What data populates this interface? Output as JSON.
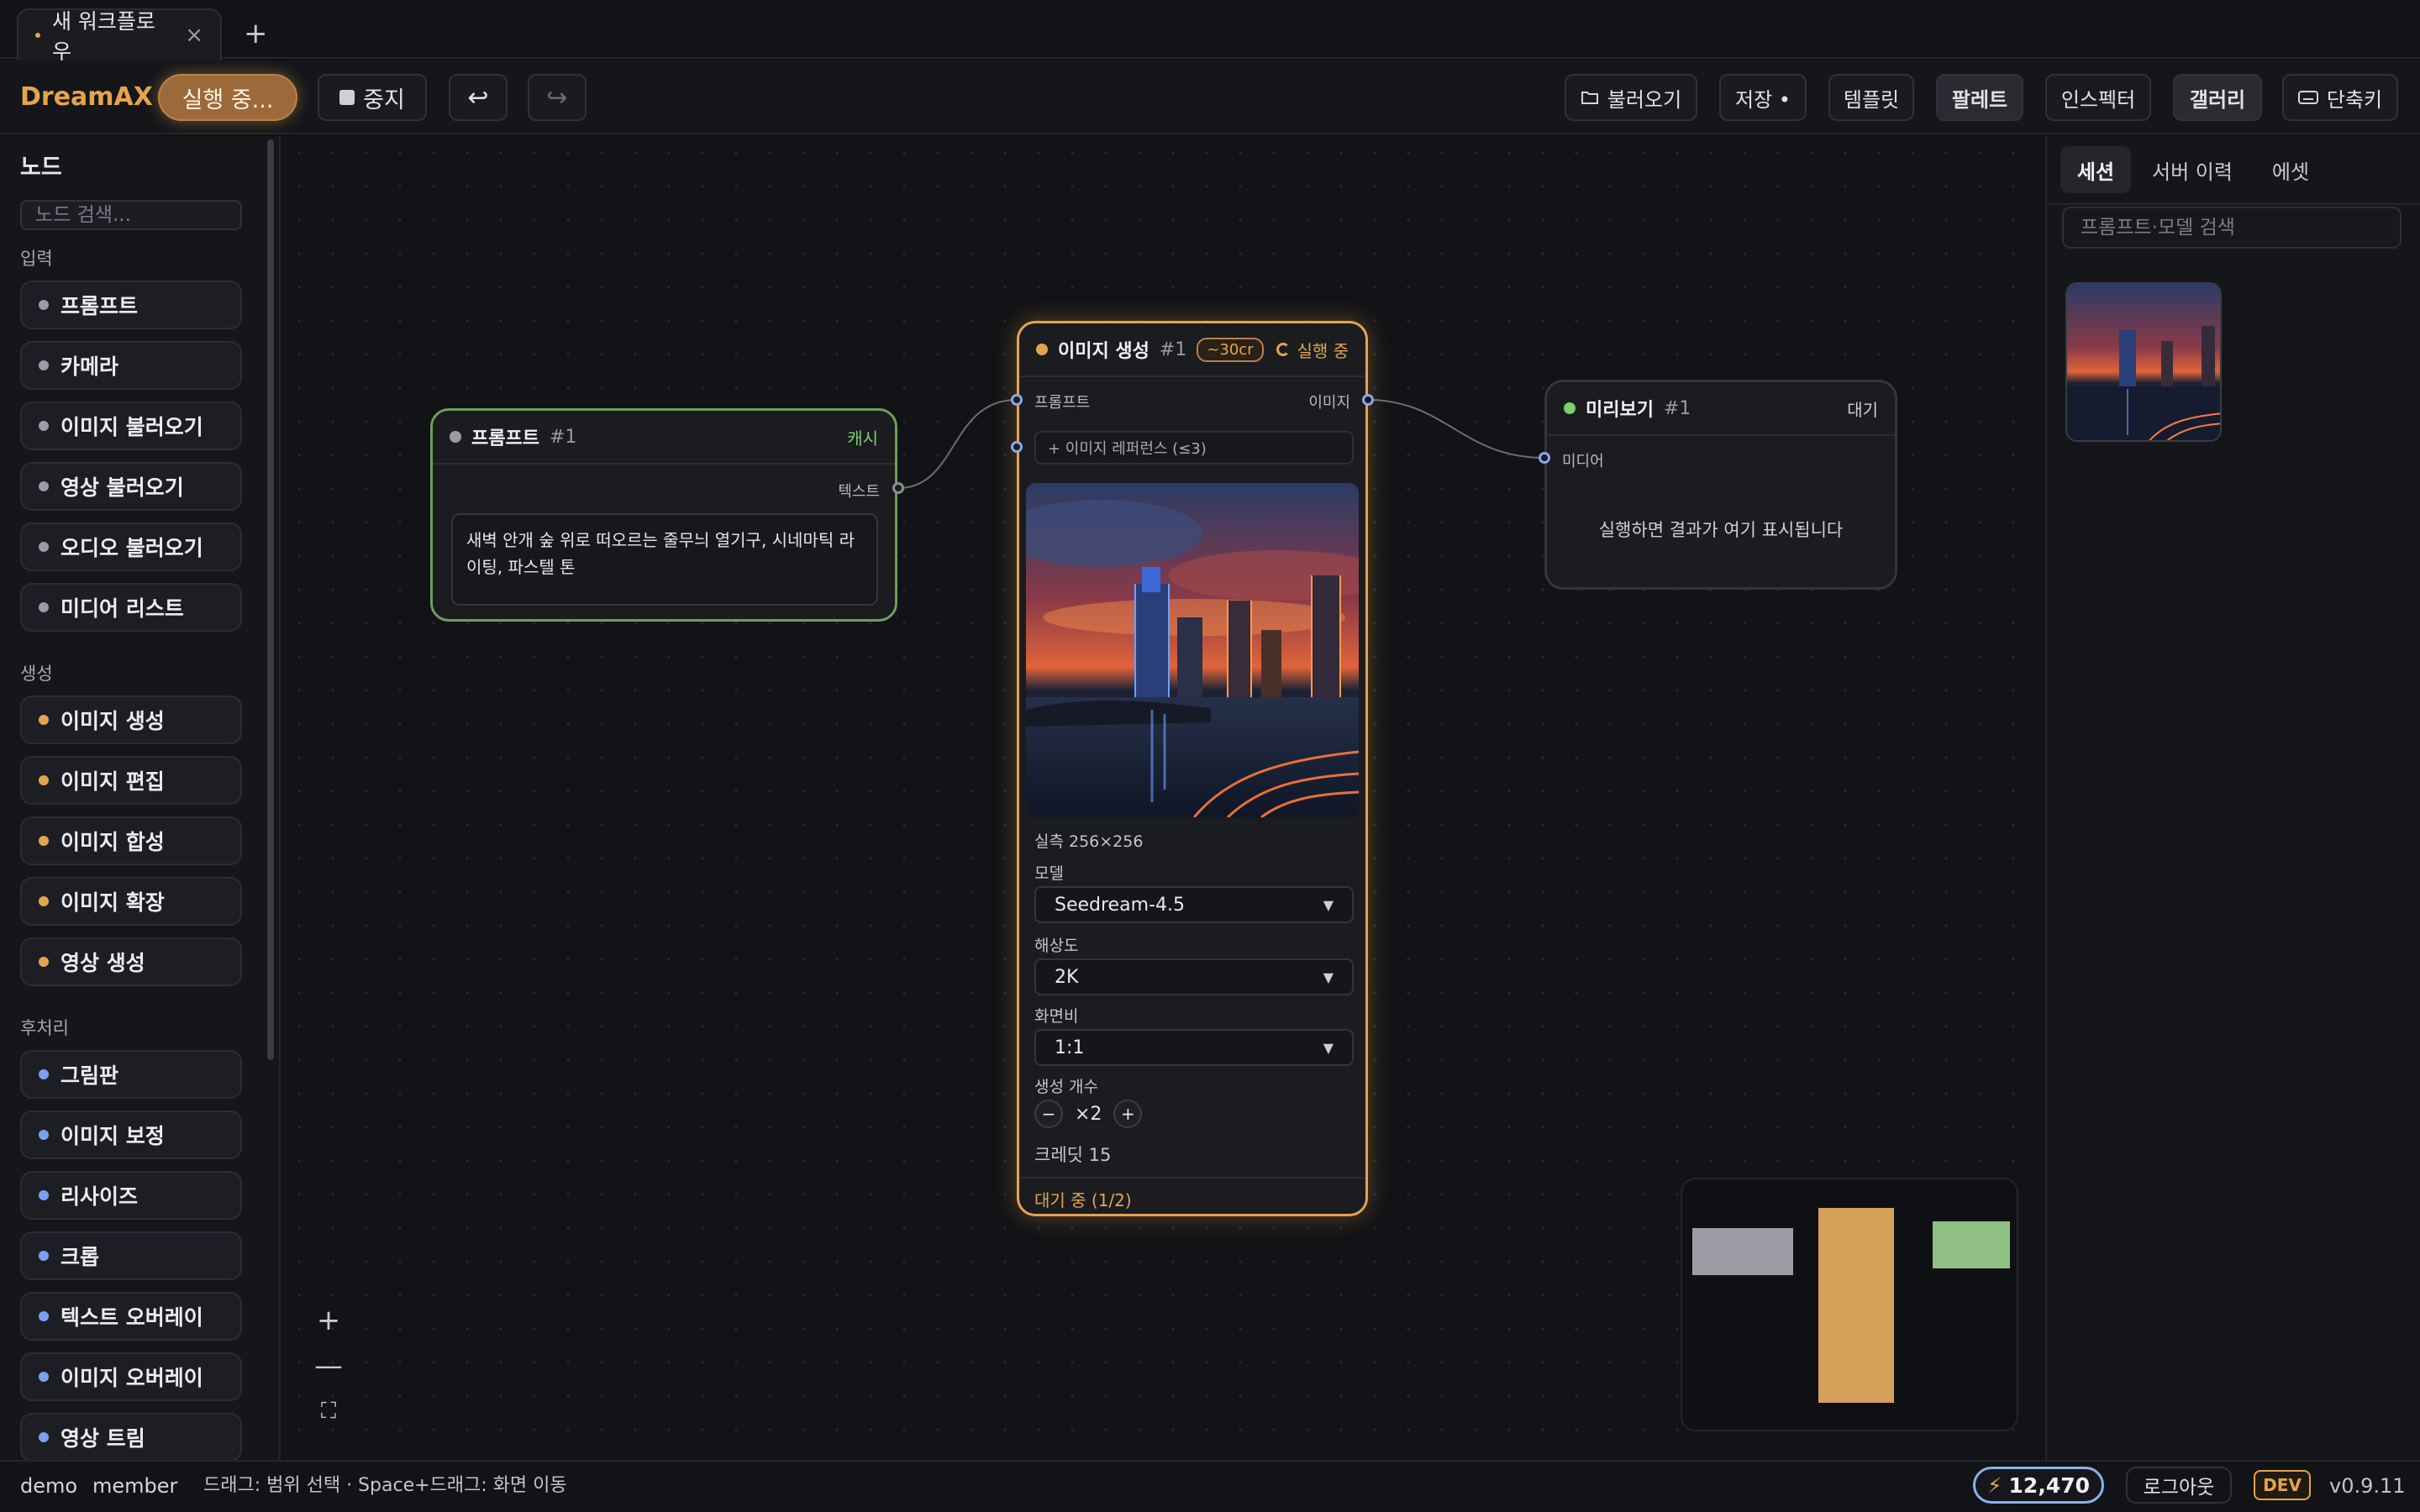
{
  "tab": {
    "title": "새 워크플로우",
    "close": "×",
    "new": "+"
  },
  "toolbar": {
    "logo": "DreamAX",
    "running": "실행 중...",
    "stop": "중지",
    "undo": "↩",
    "redo": "↪",
    "load": "불러오기",
    "save": "저장 •",
    "template": "템플릿",
    "palette": "팔레트",
    "inspector": "인스펙터",
    "gallery": "갤러리",
    "shortcuts": "단축키"
  },
  "sidebar": {
    "title": "노드",
    "search_placeholder": "노드 검색...",
    "sections": [
      {
        "label": "입력",
        "color": "#9c9ca4",
        "items": [
          "프롬프트",
          "카메라",
          "이미지 불러오기",
          "영상 불러오기",
          "오디오 불러오기",
          "미디어 리스트"
        ]
      },
      {
        "label": "생성",
        "color": "#e5a44c",
        "items": [
          "이미지 생성",
          "이미지 편집",
          "이미지 합성",
          "이미지 확장",
          "영상 생성"
        ]
      },
      {
        "label": "후처리",
        "color": "#7aa0f5",
        "items": [
          "그림판",
          "이미지 보정",
          "리사이즈",
          "크롭",
          "텍스트 오버레이",
          "이미지 오버레이",
          "영상 트림"
        ]
      }
    ]
  },
  "canvas": {
    "zoom_in": "+",
    "zoom_out": "—",
    "fit": "⛶",
    "prompt_node": {
      "title": "프롬프트",
      "num": "#1",
      "badge": "캐시",
      "output_label": "텍스트",
      "text": "새벽 안개 숲 위로 떠오르는 줄무늬 열기구, 시네마틱 라이팅, 파스텔 톤"
    },
    "gen_node": {
      "title": "이미지 생성",
      "num": "#1",
      "cost": "~30cr",
      "status": "실행 중",
      "input_label": "프롬프트",
      "output_label": "이미지",
      "ref_label": "+ 이미지 레퍼런스 (≤3)",
      "actual_size": "실측 256×256",
      "model_label": "모델",
      "model_value": "Seedream-4.5",
      "res_label": "해상도",
      "res_value": "2K",
      "aspect_label": "화면비",
      "aspect_value": "1:1",
      "count_label": "생성 개수",
      "count_minus": "−",
      "count_value": "×2",
      "count_plus": "+",
      "credit": "크레딧 15",
      "footer": "대기 중 (1/2)"
    },
    "preview_node": {
      "title": "미리보기",
      "num": "#1",
      "status": "대기",
      "input_label": "미디어",
      "message": "실행하면 결과가 여기 표시됩니다"
    }
  },
  "right_panel": {
    "tabs": [
      "세션",
      "서버 이력",
      "에셋"
    ],
    "search_placeholder": "프롬프트·모델 검색"
  },
  "status": {
    "user": "demo",
    "role": "member",
    "hint": "드래그: 범위 선택 · Space+드래그: 화면 이동",
    "credits": "12,470",
    "logout": "로그아웃",
    "env": "DEV",
    "version": "v0.9.11"
  },
  "colors": {
    "accent": "#e5a44c",
    "prompt_border": "#6e9e5a",
    "minimap_gray": "#9a9ba3",
    "minimap_orange": "#d4a05a",
    "minimap_green": "#8fbf83"
  }
}
